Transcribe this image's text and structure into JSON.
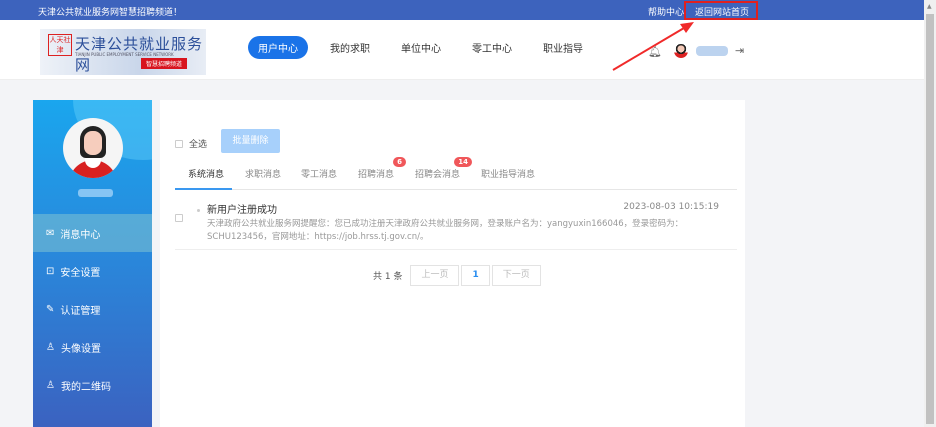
{
  "topbar": {
    "welcome": "天津公共就业服务网智慧招聘频道！",
    "help": "帮助中心",
    "home": "返回网站首页"
  },
  "logo": {
    "seal": "人天社津",
    "title": "天津公共就业服务网",
    "en": "TIANJIN PUBLIC EMPLOYMENT SERVICE NETWORK",
    "tag": "智慧招聘频道"
  },
  "nav": [
    {
      "label": "用户中心",
      "active": true
    },
    {
      "label": "我的求职"
    },
    {
      "label": "单位中心"
    },
    {
      "label": "零工中心"
    },
    {
      "label": "职业指导"
    }
  ],
  "header_icons": {
    "bell": "bell-icon",
    "logout": "logout-icon"
  },
  "sidebar": {
    "items": [
      {
        "label": "消息中心",
        "icon": "✉",
        "active": true
      },
      {
        "label": "安全设置",
        "icon": "🔒"
      },
      {
        "label": "认证管理",
        "icon": "✎"
      },
      {
        "label": "头像设置",
        "icon": "♙"
      },
      {
        "label": "我的二维码",
        "icon": "♙"
      }
    ]
  },
  "toolbar": {
    "select_all": "全选",
    "batch_delete": "批量删除"
  },
  "tabs": [
    {
      "label": "系统消息"
    },
    {
      "label": "求职消息"
    },
    {
      "label": "零工消息"
    },
    {
      "label": "招聘消息",
      "badge": "6"
    },
    {
      "label": "招聘会消息",
      "badge": "14"
    },
    {
      "label": "职业指导消息"
    }
  ],
  "messages": [
    {
      "title": "新用户注册成功",
      "time": "2023-08-03 10:15:19",
      "body": "天津政府公共就业服务网提醒您：您已成功注册天津政府公共就业服务网，登录账户名为：yangyuxin166046，登录密码为：SCHU123456，官网地址：https://job.hrss.tj.gov.cn/。"
    }
  ],
  "pager": {
    "total": "共 1 条",
    "prev": "上一页",
    "current": "1",
    "next": "下一页"
  },
  "colors": {
    "topbar": "#3d63bd",
    "accent": "#1a73e8",
    "badge": "#f0575a",
    "highlight": "#e02020"
  }
}
